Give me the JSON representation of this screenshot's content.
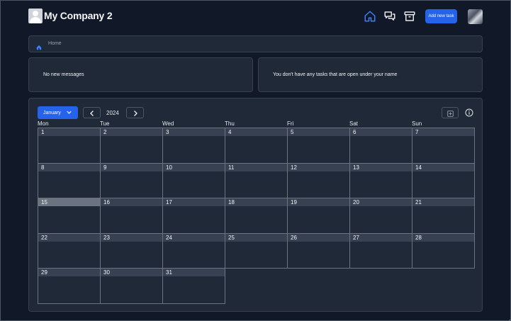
{
  "header": {
    "company_name": "My Company 2",
    "add_task_label": "Add new task",
    "nav_icons": [
      "home-icon",
      "chat-icon",
      "archive-icon"
    ],
    "accent_color": "#2563eb"
  },
  "breadcrumb": {
    "items": [
      "Home"
    ]
  },
  "cards": {
    "messages": "No new messages",
    "tasks": "You don't have any tasks that are open under your name"
  },
  "calendar": {
    "month": "January",
    "year": "2024",
    "weekdays": [
      "Mon",
      "Tue",
      "Wed",
      "Thu",
      "Fri",
      "Sat",
      "Sun"
    ],
    "first_weekday_index": 0,
    "days_in_month": 31,
    "highlighted_day": 15
  }
}
